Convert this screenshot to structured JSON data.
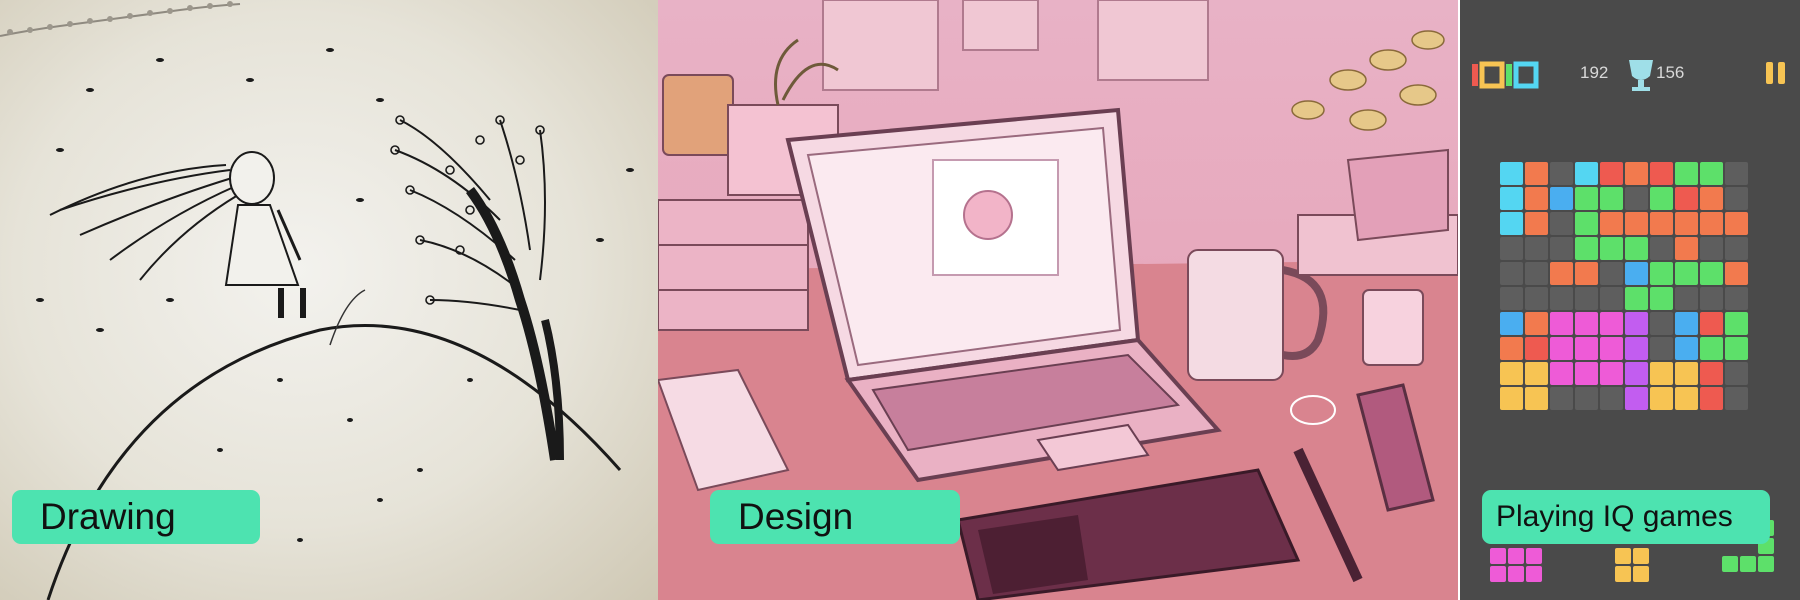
{
  "panels": [
    {
      "label": "Drawing"
    },
    {
      "label": "Design"
    },
    {
      "label": "Playing IQ games"
    }
  ],
  "game": {
    "current_score": "192",
    "best_score": "156",
    "logo_icon": "1010-logo-icon",
    "trophy_icon": "trophy-icon",
    "pause_icon": "pause-icon"
  },
  "colors": {
    "label_bg": "#4de3b0",
    "cyan": "#54d6f2",
    "orange": "#f27a4e",
    "green": "#5de06a",
    "blue": "#4aaef0",
    "red": "#ee5a50",
    "pink": "#ee5bd7",
    "purple": "#c25df0",
    "yellow": "#f7c453",
    "empty": "#5e5e5e"
  }
}
